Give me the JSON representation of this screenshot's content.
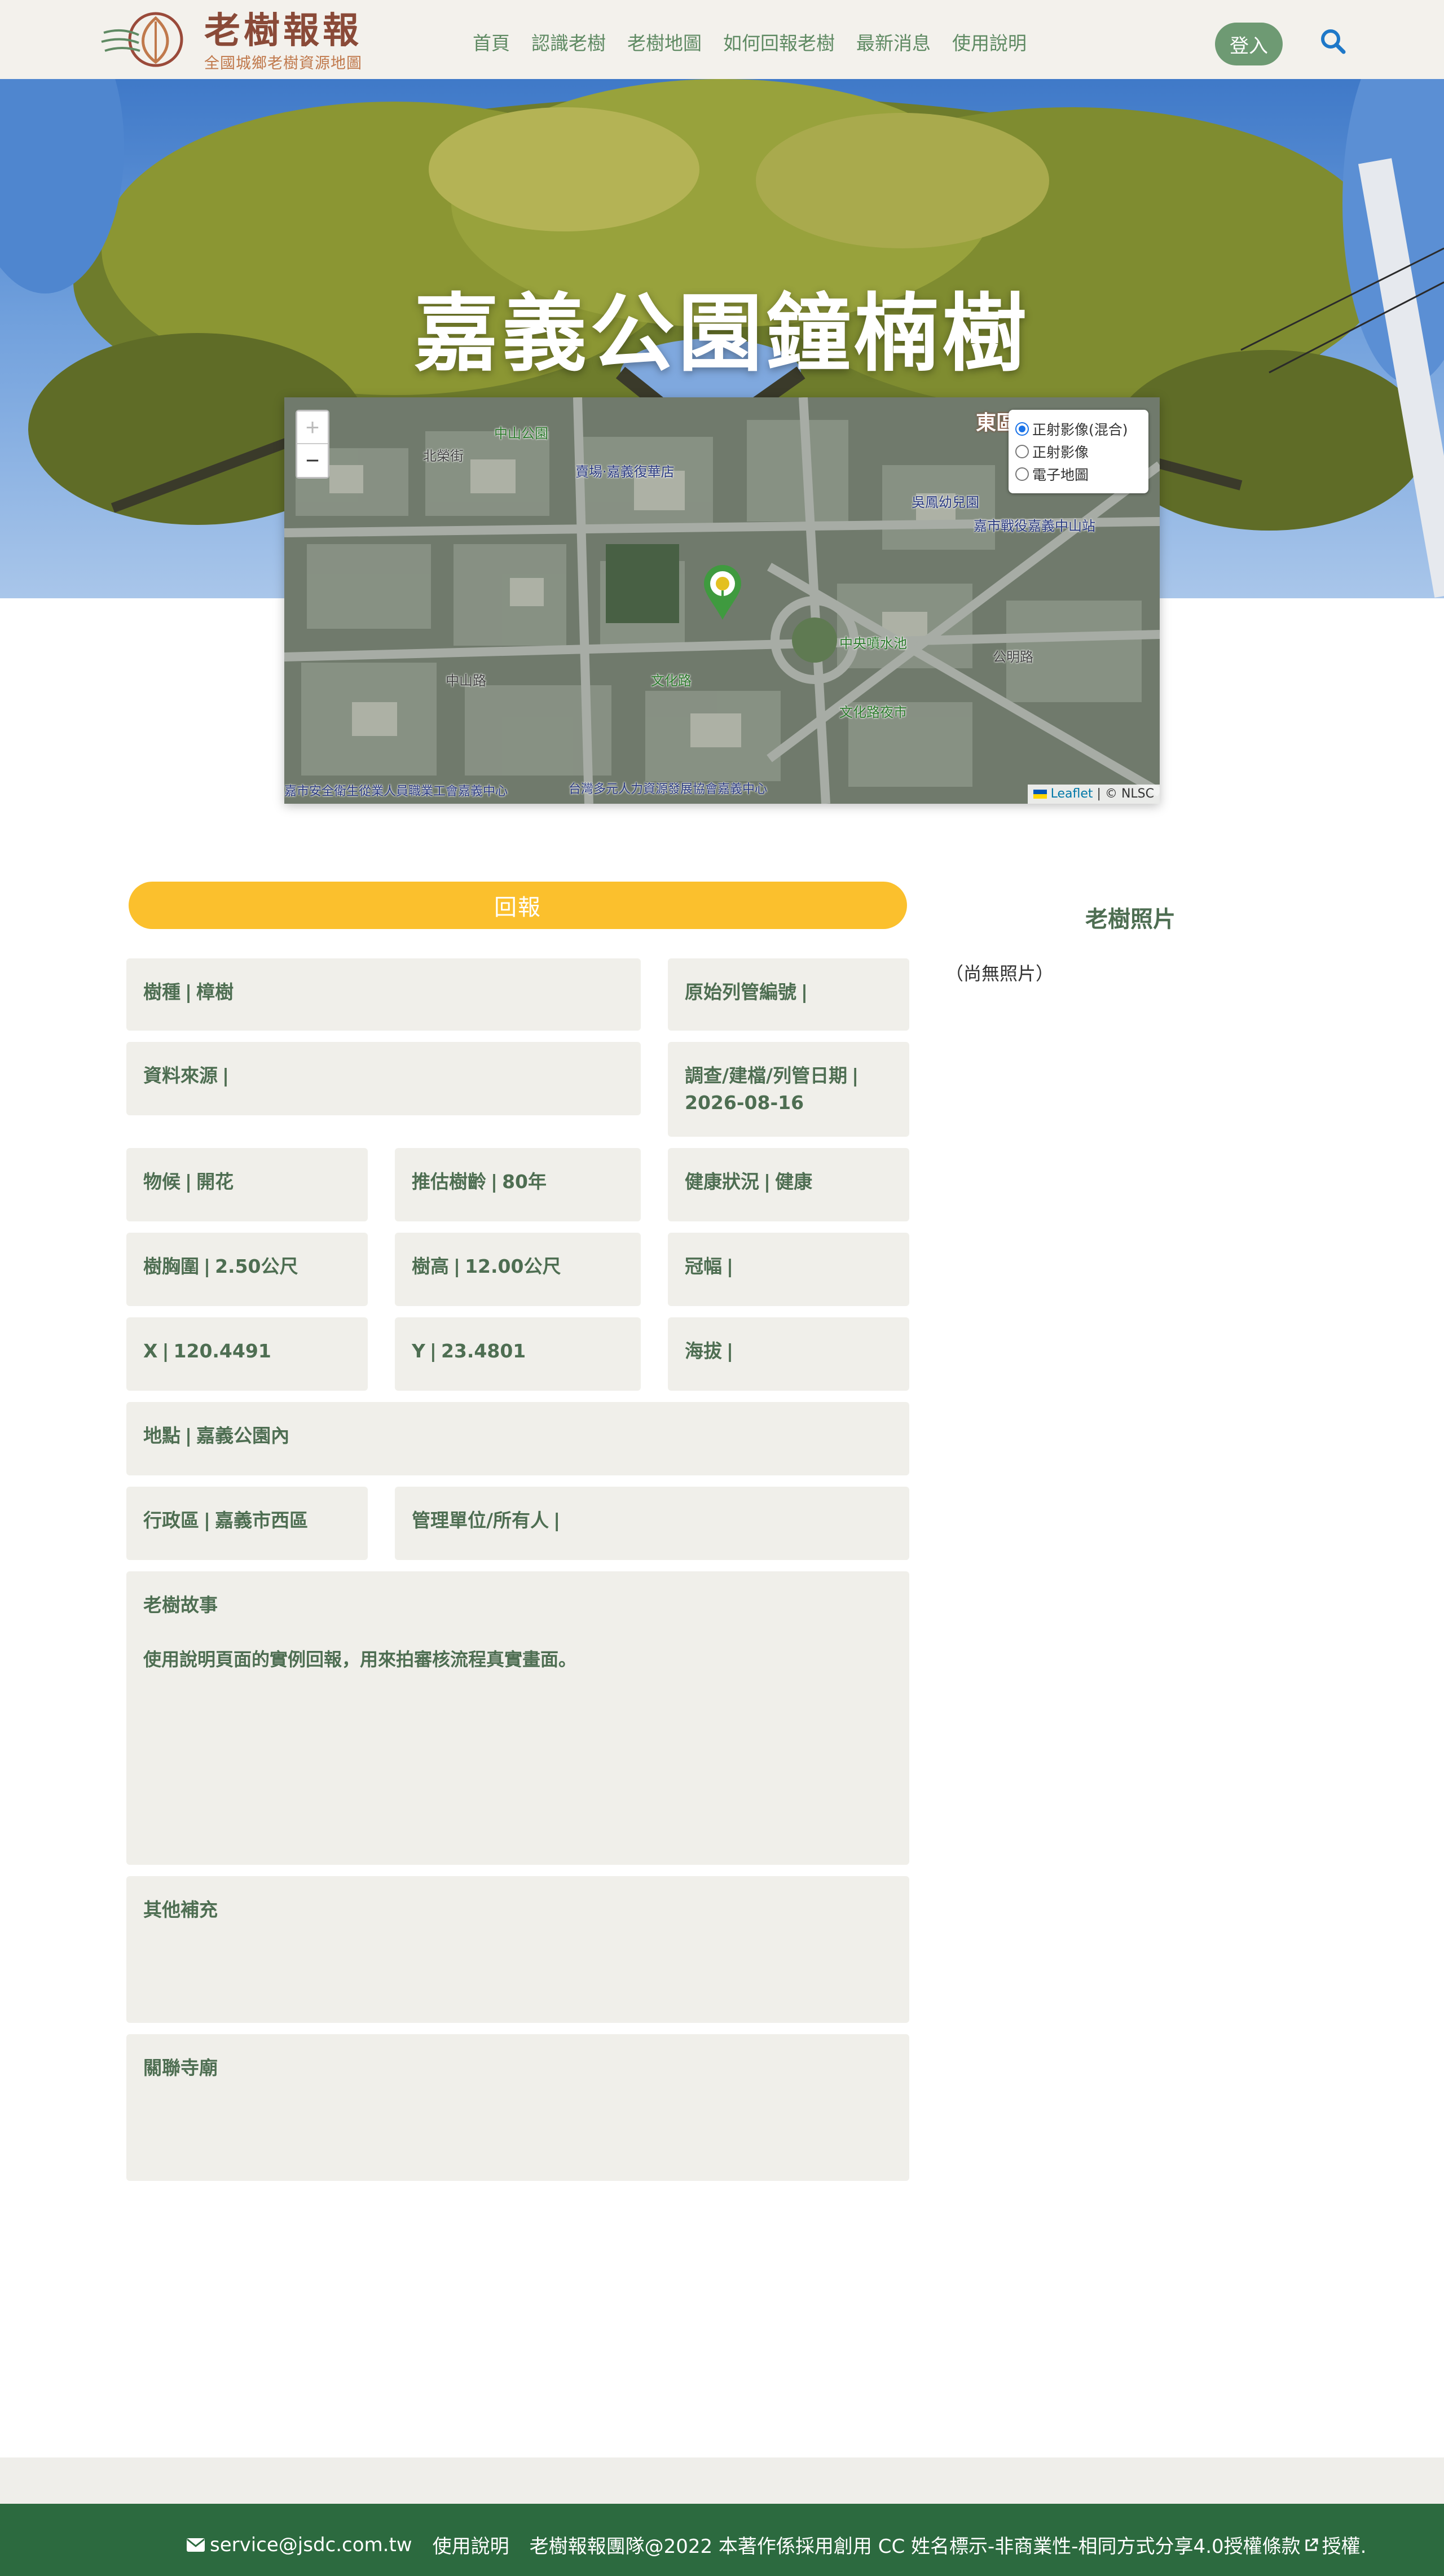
{
  "header": {
    "logo_title": "老樹報報",
    "logo_subtitle": "全國城鄉老樹資源地圖",
    "nav": [
      "首頁",
      "認識老樹",
      "老樹地圖",
      "如何回報老樹",
      "最新消息",
      "使用說明"
    ],
    "login_label": "登入",
    "search_icon": "search-icon"
  },
  "hero": {
    "title": "嘉義公園鐘楠樹"
  },
  "map": {
    "zoom_in": "+",
    "zoom_out": "−",
    "layers": [
      {
        "label": "正射影像(混合)",
        "selected": true
      },
      {
        "label": "正射影像",
        "selected": false
      },
      {
        "label": "電子地圖",
        "selected": false
      }
    ],
    "attribution_leaflet": "Leaflet",
    "attribution_rest": "| © NLSC",
    "labels": {
      "park": "中山公園",
      "north": "北榮街",
      "bookstore": "賣場·嘉義復華店",
      "kindergarten": "吳鳳幼兒園",
      "station": "嘉市戰役嘉義中山站",
      "fountain": "中央噴水池",
      "gongming": "公明路",
      "zhongshan": "中山路",
      "culture_road": "文化路",
      "night_market": "文化路夜市",
      "east": "東區",
      "bottom_center": "台灣多元人力資源發展協會嘉義中心",
      "bottom_left": "嘉市安全衛生從業人員職業工會嘉義中心"
    }
  },
  "report": {
    "button_label": "回報"
  },
  "details": {
    "species": {
      "label": "樹種",
      "value": "樟樹"
    },
    "original_id": {
      "label": "原始列管編號",
      "value": ""
    },
    "source": {
      "label": "資料來源",
      "value": ""
    },
    "survey_date": {
      "label": "調查/建檔/列管日期",
      "value": "2026-08-16"
    },
    "phenology": {
      "label": "物候",
      "value": "開花"
    },
    "age": {
      "label": "推估樹齡",
      "value": "80年"
    },
    "health": {
      "label": "健康狀況",
      "value": "健康"
    },
    "dbh": {
      "label": "樹胸圍",
      "value": "2.50公尺"
    },
    "height": {
      "label": "樹高",
      "value": "12.00公尺"
    },
    "crown": {
      "label": "冠幅",
      "value": ""
    },
    "x": {
      "label": "X",
      "value": "120.4491"
    },
    "y": {
      "label": "Y",
      "value": "23.4801"
    },
    "altitude": {
      "label": "海拔",
      "value": ""
    },
    "location": {
      "label": "地點",
      "value": "嘉義公園內"
    },
    "district": {
      "label": "行政區",
      "value": "嘉義市西區"
    },
    "owner": {
      "label": "管理單位/所有人",
      "value": ""
    },
    "story_label": "老樹故事",
    "story_text": "使用說明頁面的實例回報，用來拍審核流程真實畫面。",
    "other_label": "其他補充",
    "temple_label": "關聯寺廟"
  },
  "photos": {
    "title": "老樹照片",
    "empty": "（尚無照片）"
  },
  "footer": {
    "email": "service@jsdc.com.tw",
    "help": "使用說明",
    "copyright": "老樹報報團隊@2022 本著作係採用創用 CC 姓名標示-非商業性-相同方式分享4.0授權條款",
    "license_suffix": "授權."
  },
  "colors": {
    "accent_green": "#4e6e52",
    "button_yellow": "#fbc02d",
    "footer_green": "#2c6a3f",
    "card_bg": "#f0efea"
  }
}
